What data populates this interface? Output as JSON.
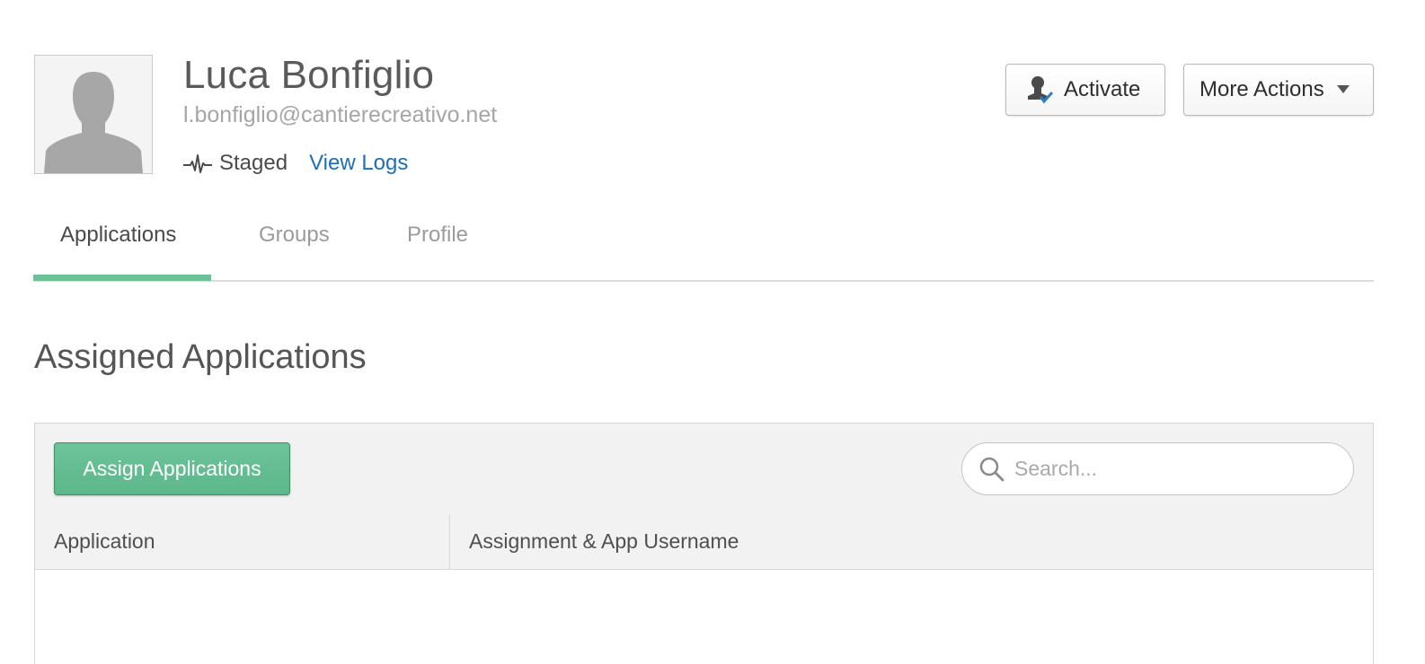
{
  "user": {
    "name": "Luca Bonfiglio",
    "email": "l.bonfiglio@cantierecreativo.net",
    "status": "Staged",
    "view_logs_label": "View Logs"
  },
  "actions": {
    "activate_label": "Activate",
    "more_actions_label": "More Actions"
  },
  "tabs": [
    {
      "label": "Applications",
      "active": true
    },
    {
      "label": "Groups",
      "active": false
    },
    {
      "label": "Profile",
      "active": false
    }
  ],
  "section": {
    "title": "Assigned Applications",
    "assign_button_label": "Assign Applications",
    "search_placeholder": "Search...",
    "columns": [
      "Application",
      "Assignment & App Username"
    ],
    "rows": []
  },
  "icons": {
    "avatar": "user-silhouette",
    "status": "pulse-icon",
    "activate": "person-check-icon",
    "more_actions": "caret-down-icon",
    "search": "search-icon"
  },
  "colors": {
    "accent_green": "#6cc197",
    "link_blue": "#1f6fb5"
  }
}
